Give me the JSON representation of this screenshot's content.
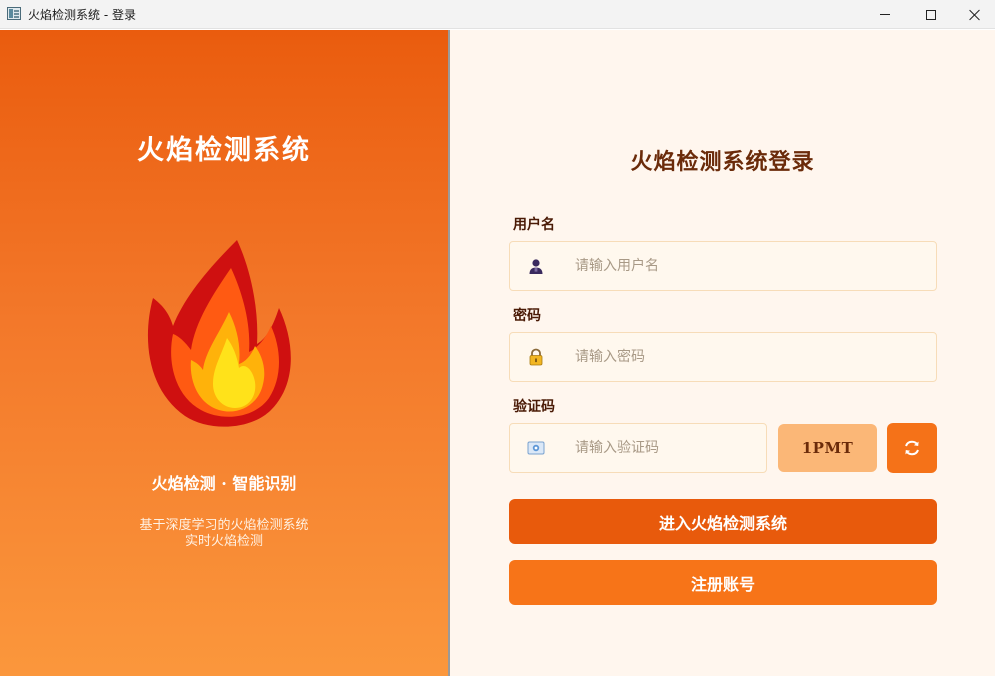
{
  "window": {
    "title": "火焰检测系统 - 登录"
  },
  "left": {
    "brand_title": "火焰检测系统",
    "tagline": "火焰检测  ·  智能识别",
    "desc_line1": "基于深度学习的火焰检测系统",
    "desc_line2": "实时火焰检测"
  },
  "login": {
    "title": "火焰检测系统登录",
    "username_label": "用户名",
    "username_placeholder": "请输入用户名",
    "password_label": "密码",
    "password_placeholder": "请输入密码",
    "captcha_label": "验证码",
    "captcha_placeholder": "请输入验证码",
    "captcha_code": "1PMT",
    "submit_label": "进入火焰检测系统",
    "register_label": "注册账号"
  },
  "icons": {
    "user": "user-icon",
    "lock": "lock-icon",
    "captcha": "captcha-image-icon",
    "refresh": "refresh-icon",
    "flame": "flame-icon"
  },
  "colors": {
    "accent": "#e85a0c",
    "accent_light": "#f77418",
    "captcha_bg": "#fbb777",
    "panel_bg": "#fff6ee"
  }
}
